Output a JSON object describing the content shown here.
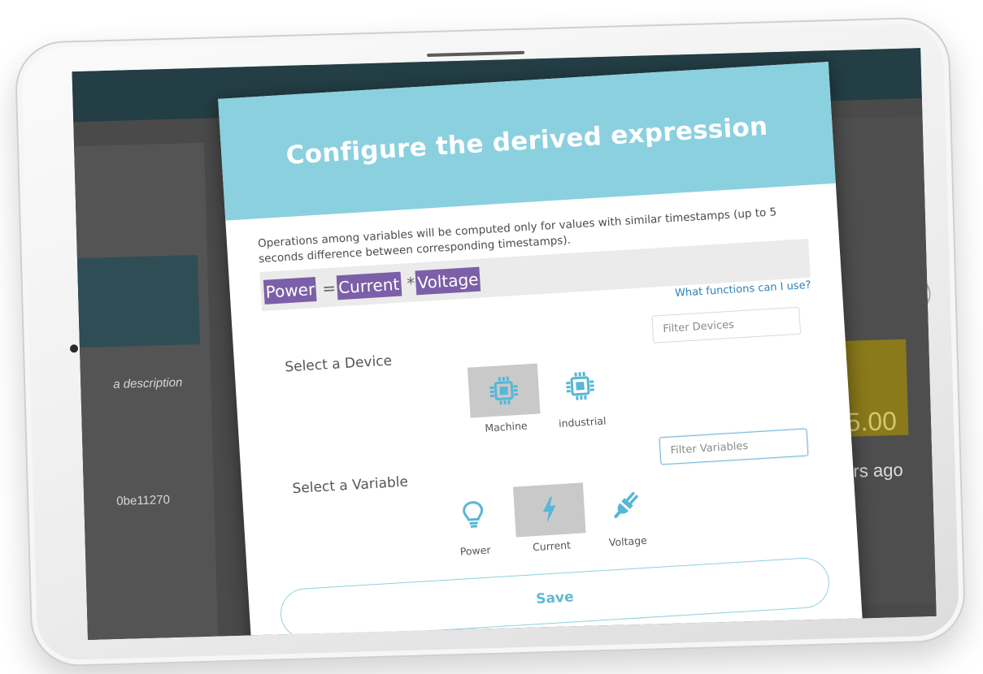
{
  "modal": {
    "title": "Configure the derived expression",
    "intro": "Operations among variables will be computed only for values with similar timestamps (up to 5 seconds difference between corresponding timestamps).",
    "expression": {
      "tokens": [
        {
          "text": "Power",
          "type": "variable"
        },
        {
          "text": "=",
          "type": "operator"
        },
        {
          "text": "Current",
          "type": "variable"
        },
        {
          "text": "*",
          "type": "operator"
        },
        {
          "text": "Voltage",
          "type": "variable"
        }
      ]
    },
    "help_link": "What functions can I use?",
    "device_section": {
      "label": "Select a Device",
      "filter_placeholder": "Filter Devices",
      "devices": [
        {
          "label": "Machine",
          "icon": "chip-icon",
          "selected": true
        },
        {
          "label": "industrial",
          "icon": "chip-icon",
          "selected": false
        }
      ]
    },
    "variable_section": {
      "label": "Select a Variable",
      "filter_placeholder": "Filter Variables",
      "variables": [
        {
          "label": "Power",
          "icon": "lightbulb-icon",
          "selected": false
        },
        {
          "label": "Current",
          "icon": "lightning-icon",
          "selected": true
        },
        {
          "label": "Voltage",
          "icon": "plug-icon",
          "selected": false
        }
      ]
    },
    "save_label": "Save"
  },
  "background": {
    "left_description": "a description",
    "left_id": "0be11270",
    "right_value": "5.00",
    "right_time": "hours ago"
  },
  "colors": {
    "header": "#8bd0de",
    "token": "#7b5fa8",
    "icon": "#56b7d6",
    "link": "#2a82b8"
  }
}
